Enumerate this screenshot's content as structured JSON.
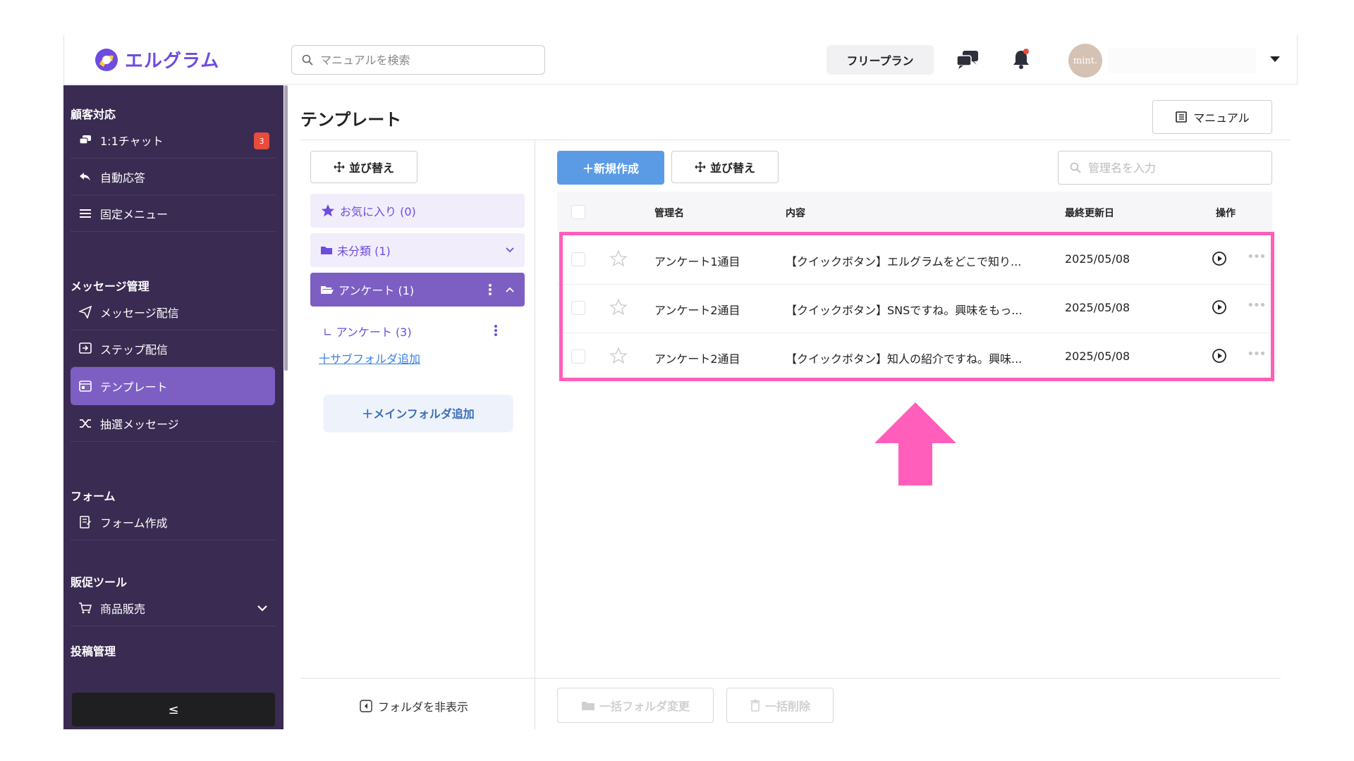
{
  "brand": {
    "name": "エルグラム",
    "color": "#6e4ce0"
  },
  "header": {
    "search_placeholder": "マニュアルを検索",
    "plan_label": "フリープラン",
    "avatar_text": "mint.",
    "icons": [
      "chat-bubbles-icon",
      "bell-icon",
      "caret-down-icon"
    ]
  },
  "sidebar": {
    "sections": [
      {
        "title": "顧客対応"
      },
      {
        "title": "メッセージ管理"
      },
      {
        "title": "フォーム"
      },
      {
        "title": "販促ツール"
      },
      {
        "title": "投稿管理"
      }
    ],
    "items": [
      {
        "label": "1:1チャット",
        "icon": "chat-icon",
        "badge": "3"
      },
      {
        "label": "自動応答",
        "icon": "reply-icon"
      },
      {
        "label": "固定メニュー",
        "icon": "menu-icon"
      },
      {
        "label": "メッセージ配信",
        "icon": "send-icon"
      },
      {
        "label": "ステップ配信",
        "icon": "step-icon"
      },
      {
        "label": "テンプレート",
        "icon": "template-icon",
        "active": true
      },
      {
        "label": "抽選メッセージ",
        "icon": "shuffle-icon"
      },
      {
        "label": "フォーム作成",
        "icon": "form-icon"
      },
      {
        "label": "商品販売",
        "icon": "cart-icon"
      }
    ],
    "collapse_label": "≤"
  },
  "page": {
    "title": "テンプレート",
    "manual_label": "マニュアル"
  },
  "folders": {
    "sort_label": "並び替え",
    "favorites": "お気に入り (0)",
    "uncategorized": "未分類 (1)",
    "active_folder": "アンケート (1)",
    "sub_folder": "∟ アンケート (3)",
    "add_sub": "十サブフォルダ追加",
    "add_main": "＋メインフォルダ追加",
    "hide_label": "フォルダを非表示"
  },
  "list": {
    "new_label": "＋新規作成",
    "sort_label": "並び替え",
    "filter_placeholder": "管理名を入力",
    "columns": {
      "name": "管理名",
      "content": "内容",
      "updated": "最終更新日",
      "actions": "操作"
    },
    "rows": [
      {
        "name": "アンケート1通目",
        "content": "【クイックボタン】エルグラムをどこで知り...",
        "updated": "2025/05/08"
      },
      {
        "name": "アンケート2通目",
        "content": "【クイックボタン】SNSですね。興味をもっ...",
        "updated": "2025/05/08"
      },
      {
        "name": "アンケート2通目",
        "content": "【クイックボタン】知人の紹介ですね。興味...",
        "updated": "2025/05/08"
      }
    ],
    "bulk_folder": "一括フォルダ変更",
    "bulk_delete": "一括削除"
  },
  "colors": {
    "sidebar_bg": "#3a2b52",
    "accent": "#7d5fc4",
    "primary_btn": "#5b9be6",
    "highlight": "#ff5fba"
  }
}
